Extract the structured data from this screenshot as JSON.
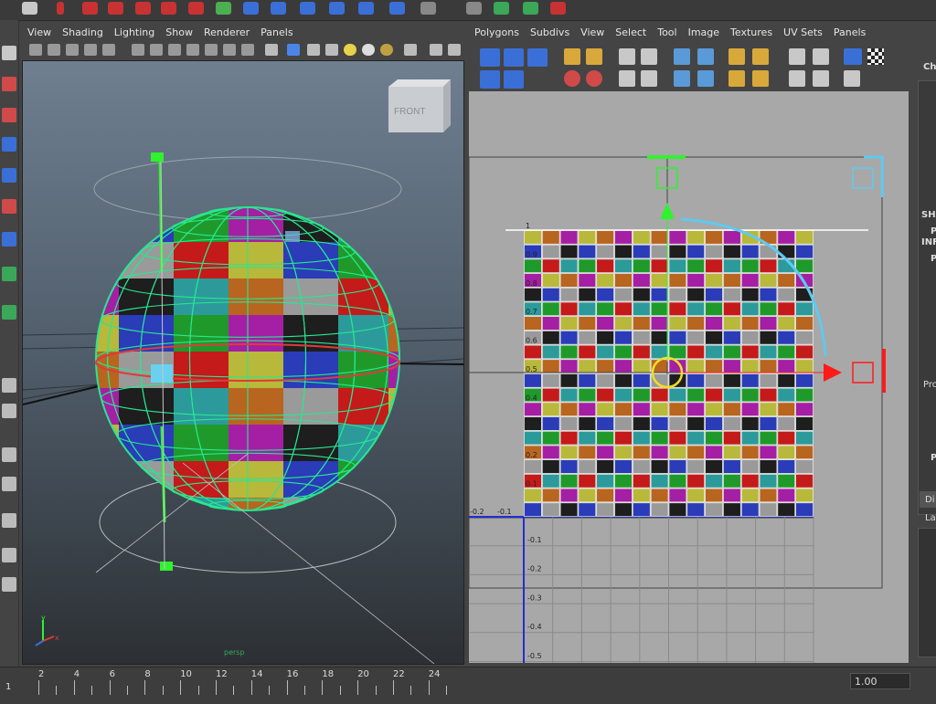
{
  "left_panel": {
    "menu": [
      "View",
      "Shading",
      "Lighting",
      "Show",
      "Renderer",
      "Panels"
    ],
    "view_cube_label": "FRONT",
    "camera_label": "persp"
  },
  "uv_editor": {
    "menu": [
      "Polygons",
      "Subdivs",
      "View",
      "Select",
      "Tool",
      "Image",
      "Textures",
      "UV Sets",
      "Panels"
    ],
    "axis_x_labels": [
      "-0.2",
      "-0.1"
    ],
    "axis_y_labels": [
      "1",
      "0.9",
      "0.8",
      "0.7",
      "0.6",
      "0.5",
      "0.4",
      "0.3",
      "0.2",
      "0.1"
    ],
    "axis_y_neg_labels": [
      "-0.1",
      "-0.2",
      "-0.3",
      "-0.4",
      "-0.5"
    ]
  },
  "right_panel": {
    "labels": [
      "Ch",
      "SHA",
      "P",
      "INF",
      "P",
      "Pro",
      "P",
      "Di",
      "La"
    ]
  },
  "timeline": {
    "frame_labels": [
      "2",
      "4",
      "6",
      "8",
      "10",
      "12",
      "14",
      "16",
      "18",
      "20",
      "22",
      "24"
    ],
    "current_frame": "1",
    "range_value": "1.00"
  },
  "colors": {
    "wireframe": "#27e891",
    "checker": [
      "#b8b83a",
      "#2c9a9a",
      "#2a3cb8",
      "#b8651f",
      "#1f9a2a",
      "#9a9a9a",
      "#a41fa4",
      "#c41a1a",
      "#1e1e1e"
    ]
  }
}
